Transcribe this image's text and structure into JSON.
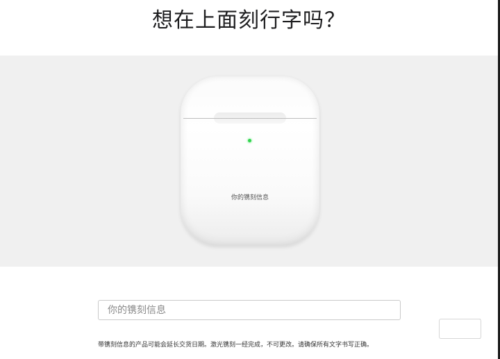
{
  "page": {
    "title": "想在上面刻行字吗？"
  },
  "preview": {
    "engraving_text": "你的镌刻信息",
    "led_color": "#32d34f",
    "background_color": "#f0f0f0"
  },
  "engraving_input": {
    "placeholder": "你的镌刻信息",
    "value": ""
  },
  "note": {
    "text": "带镌刻信息的产品可能会延长交货日期。激光镌刻一经完成，不可更改。请确保所有文字书写正确。"
  }
}
